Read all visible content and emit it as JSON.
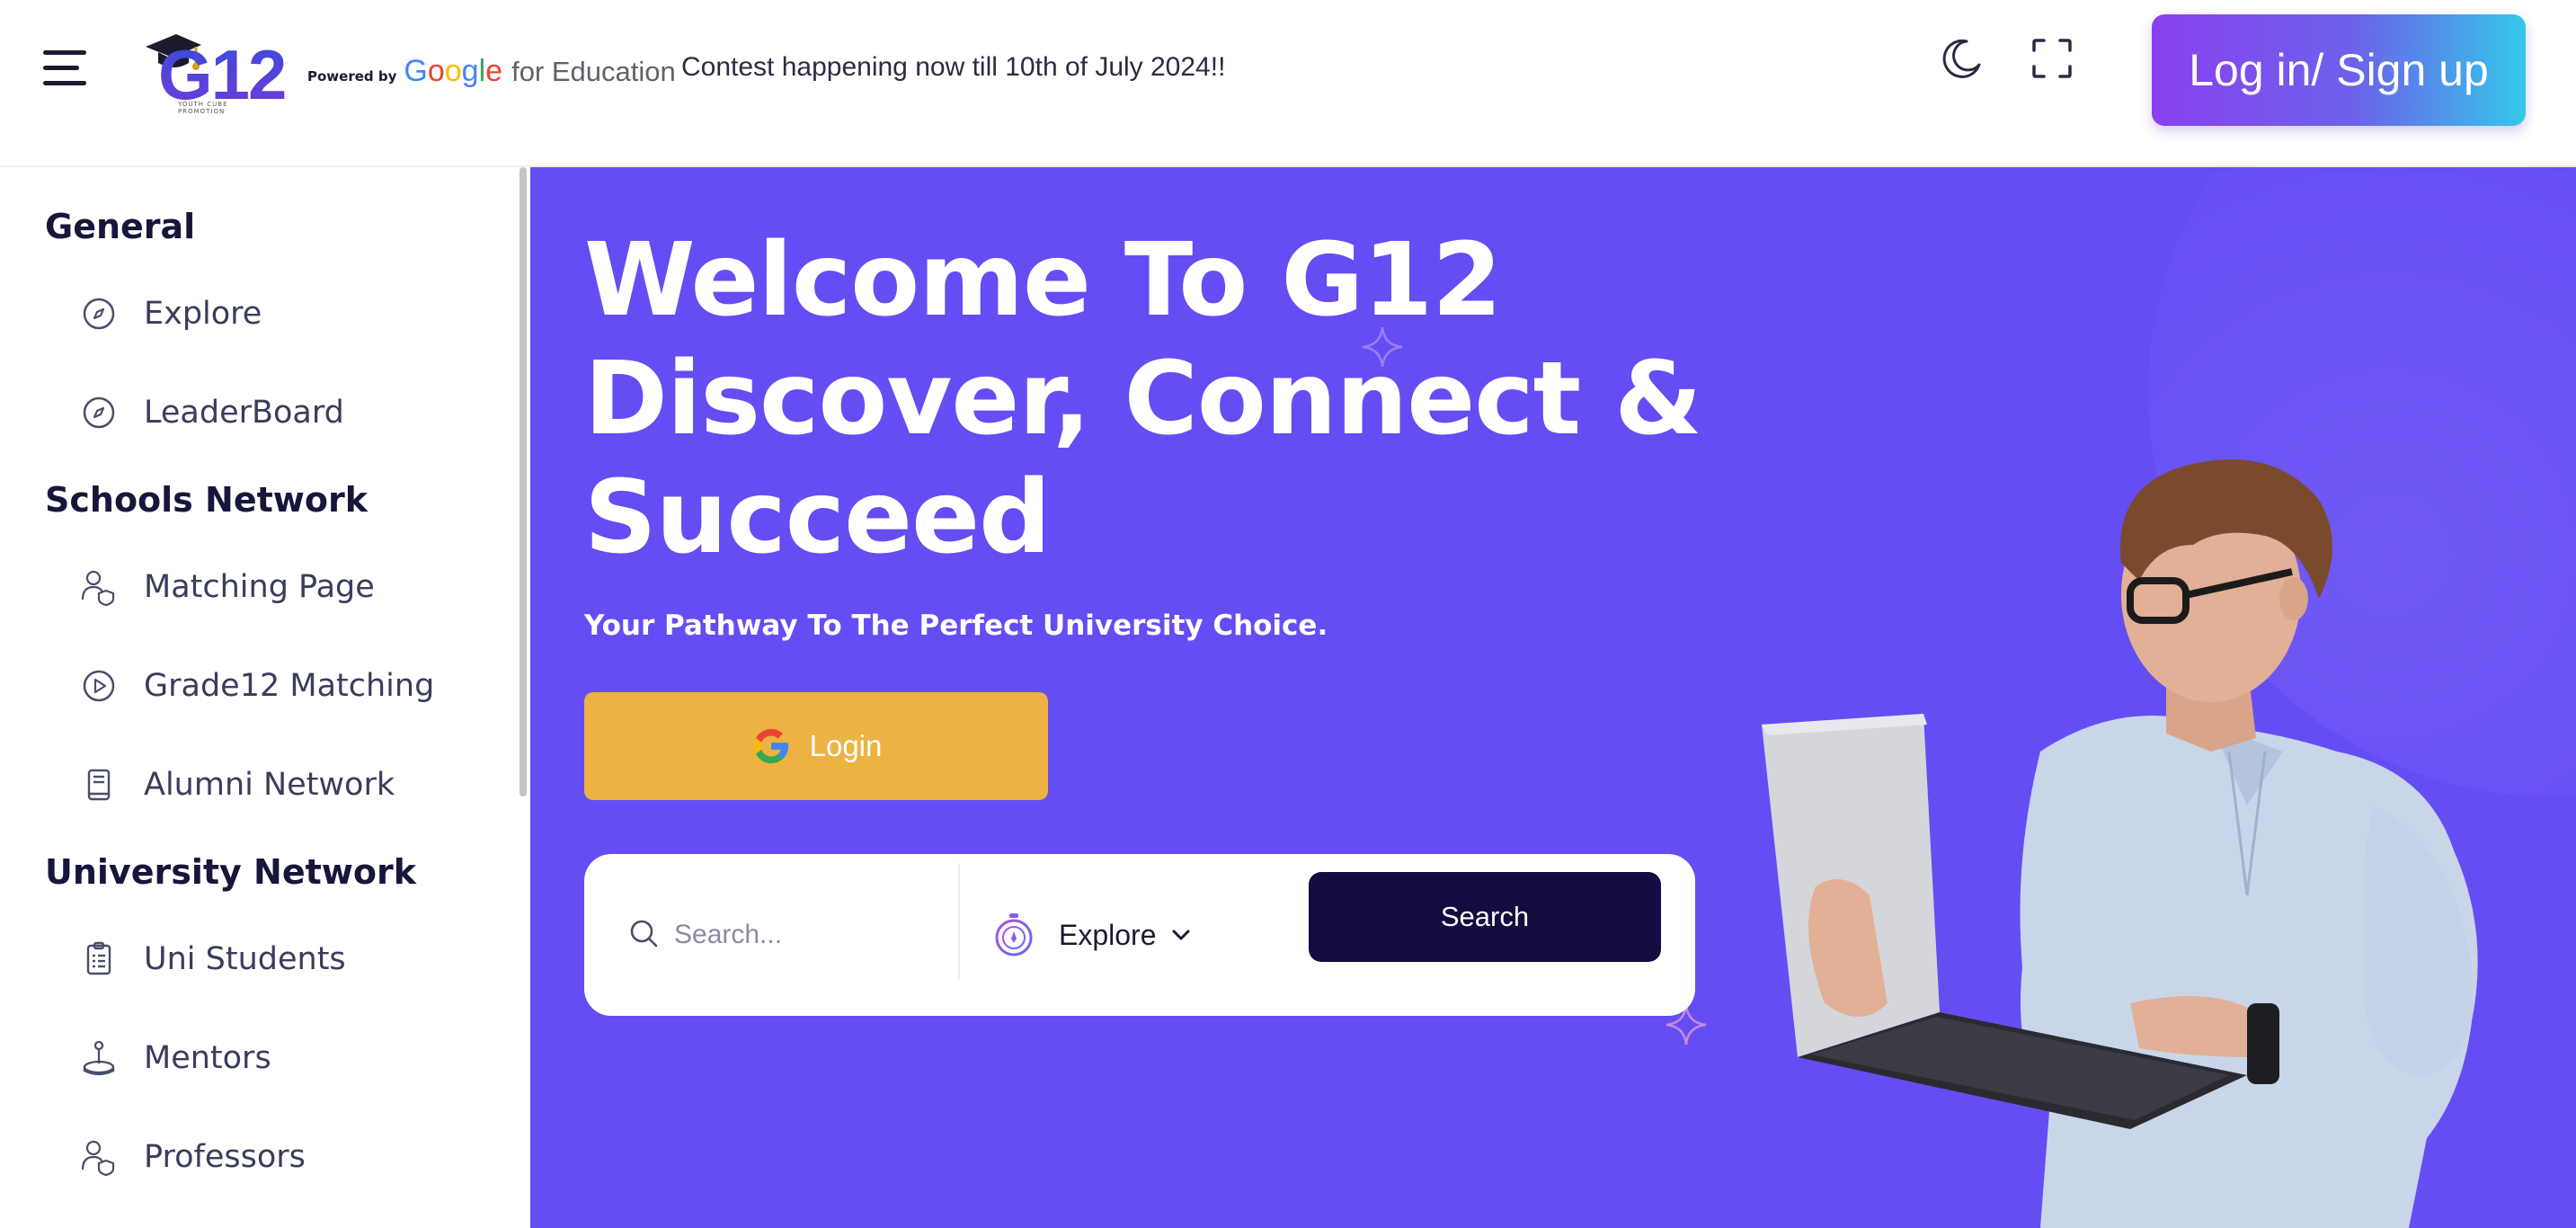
{
  "header": {
    "logo_text": "G12",
    "logo_tagline": "YOUTH CUBE PROMOTION",
    "powered_by": "Powered by",
    "google_letters": [
      "G",
      "o",
      "o",
      "g",
      "l",
      "e"
    ],
    "for_education": "for Education",
    "contest_text": "Contest happening now till 10th of July 2024!!",
    "login_signup_label": "Log in/ Sign up",
    "icons": [
      "menu-icon",
      "moon-icon",
      "fullscreen-icon"
    ]
  },
  "sidebar": {
    "sections": [
      {
        "title": "General",
        "items": [
          {
            "label": "Explore",
            "icon": "compass-icon"
          },
          {
            "label": "LeaderBoard",
            "icon": "compass-icon"
          }
        ]
      },
      {
        "title": "Schools Network",
        "items": [
          {
            "label": "Matching Page",
            "icon": "users-shield-icon"
          },
          {
            "label": "Grade12 Matching",
            "icon": "play-circle-icon"
          },
          {
            "label": "Alumni Network",
            "icon": "book-icon"
          }
        ]
      },
      {
        "title": "University Network",
        "items": [
          {
            "label": "Uni Students",
            "icon": "clipboard-list-icon"
          },
          {
            "label": "Mentors",
            "icon": "joystick-icon"
          },
          {
            "label": "Professors",
            "icon": "users-shield-icon"
          }
        ]
      }
    ]
  },
  "hero": {
    "title_lines": [
      "Welcome To G12",
      "Discover, Connect &",
      "Succeed"
    ],
    "subtitle": "Your Pathway To The Perfect University Choice.",
    "google_login_label": "Login",
    "search": {
      "placeholder": "Search...",
      "explore_label": "Explore",
      "button_label": "Search"
    }
  },
  "colors": {
    "hero_bg": "#654df4",
    "login_button": "#ecb343",
    "search_button": "#140b3f",
    "signup_gradient": [
      "#8b3ff0",
      "#34c8ea"
    ]
  }
}
